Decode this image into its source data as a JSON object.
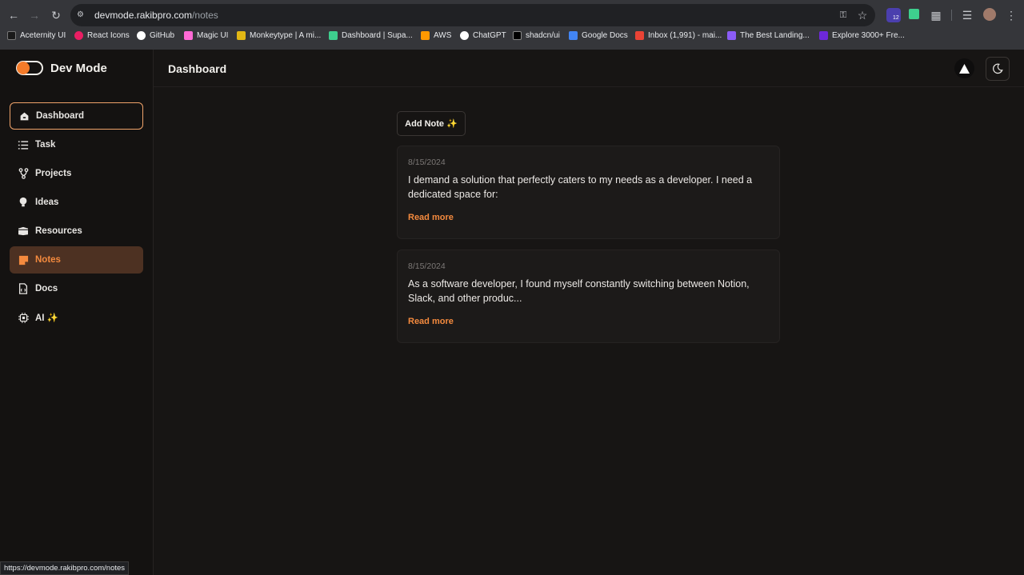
{
  "browser": {
    "url_host": "devmode.rakibpro.com",
    "url_path": "/notes",
    "bookmarks": [
      {
        "label": "Aceternity UI",
        "color": "#1a1a1a"
      },
      {
        "label": "React Icons",
        "color": "#e91e63"
      },
      {
        "label": "GitHub",
        "color": "#ffffff"
      },
      {
        "label": "Magic UI",
        "color": "#ff6ad5"
      },
      {
        "label": "Monkeytype | A mi...",
        "color": "#e2b714"
      },
      {
        "label": "Dashboard | Supa...",
        "color": "#3ecf8e"
      },
      {
        "label": "AWS",
        "color": "#ff9900"
      },
      {
        "label": "ChatGPT",
        "color": "#ffffff"
      },
      {
        "label": "shadcn/ui",
        "color": "#000000"
      },
      {
        "label": "Google Docs",
        "color": "#4285f4"
      },
      {
        "label": "Inbox (1,991) - mai...",
        "color": "#ea4335"
      },
      {
        "label": "The Best Landing...",
        "color": "#8b5cf6"
      },
      {
        "label": "Explore 3000+ Fre...",
        "color": "#6d28d9"
      }
    ],
    "extension_badge": "12",
    "status_url": "https://devmode.rakibpro.com/notes"
  },
  "app": {
    "name": "Dev Mode",
    "page_title": "Dashboard",
    "accent": "#f48a3e"
  },
  "sidebar": {
    "items": [
      {
        "label": "Dashboard",
        "icon": "home-icon"
      },
      {
        "label": "Task",
        "icon": "list-icon"
      },
      {
        "label": "Projects",
        "icon": "git-branch-icon"
      },
      {
        "label": "Ideas",
        "icon": "lightbulb-icon"
      },
      {
        "label": "Resources",
        "icon": "box-icon"
      },
      {
        "label": "Notes",
        "icon": "note-icon"
      },
      {
        "label": "Docs",
        "icon": "document-icon"
      },
      {
        "label": "AI ✨",
        "icon": "chip-icon"
      }
    ]
  },
  "main": {
    "add_note_label": "Add Note ✨",
    "notes": [
      {
        "date": "8/15/2024",
        "text": "I demand a solution that perfectly caters to my needs as a developer. I need a dedicated space for:",
        "link": "Read more"
      },
      {
        "date": "8/15/2024",
        "text": "As a software developer, I found myself constantly switching between Notion, Slack, and other produc...",
        "link": "Read more"
      }
    ]
  }
}
